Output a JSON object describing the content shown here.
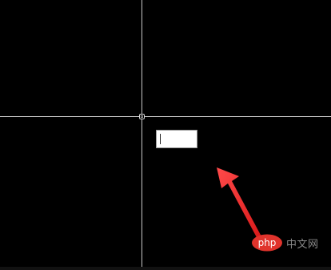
{
  "viewport": {
    "background": "#000000",
    "crosshair_color": "#c8c8c8"
  },
  "dynamic_input": {
    "value": ""
  },
  "annotation": {
    "arrow_color": "#ff2a2a"
  },
  "watermark": {
    "logo_text": "php",
    "site_text": "中文网"
  }
}
